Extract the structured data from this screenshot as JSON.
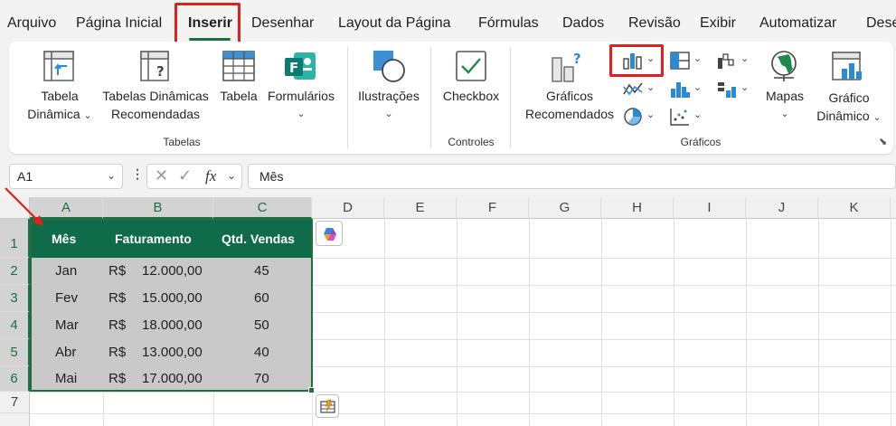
{
  "menu": {
    "tabs": [
      "Arquivo",
      "Página Inicial",
      "Inserir",
      "Desenhar",
      "Layout da Página",
      "Fórmulas",
      "Dados",
      "Revisão",
      "Exibir",
      "Automatizar",
      "Dese"
    ],
    "active": "Inserir"
  },
  "ribbon": {
    "tabela_dinamica": [
      "Tabela",
      "Dinâmica"
    ],
    "tabelas_recomendadas": [
      "Tabelas Dinâmicas",
      "Recomendadas"
    ],
    "tabela": "Tabela",
    "formularios": "Formulários",
    "ilustracoes": "Ilustrações",
    "checkbox": "Checkbox",
    "graficos_recomendados": [
      "Gráficos",
      "Recomendados"
    ],
    "mapas": "Mapas",
    "grafico_dinamico": [
      "Gráfico",
      "Dinâmico"
    ],
    "groups": {
      "tabelas": "Tabelas",
      "controles": "Controles",
      "graficos": "Gráficos"
    }
  },
  "formula_bar": {
    "name_box": "A1",
    "fx": "fx",
    "formula": "Mês"
  },
  "sheet": {
    "columns": [
      "A",
      "B",
      "C",
      "D",
      "E",
      "F",
      "G",
      "H",
      "I",
      "J",
      "K"
    ],
    "rows": [
      "1",
      "2",
      "3",
      "4",
      "5",
      "6",
      "7"
    ],
    "headers": [
      "Mês",
      "Faturamento",
      "Qtd. Vendas"
    ],
    "data": [
      {
        "mes": "Jan",
        "moeda": "R$",
        "valor": "12.000,00",
        "qtd": "45"
      },
      {
        "mes": "Fev",
        "moeda": "R$",
        "valor": "15.000,00",
        "qtd": "60"
      },
      {
        "mes": "Mar",
        "moeda": "R$",
        "valor": "18.000,00",
        "qtd": "50"
      },
      {
        "mes": "Abr",
        "moeda": "R$",
        "valor": "13.000,00",
        "qtd": "40"
      },
      {
        "mes": "Mai",
        "moeda": "R$",
        "valor": "17.000,00",
        "qtd": "70"
      }
    ]
  },
  "colors": {
    "accent": "#1d6f42",
    "header_fill": "#0f6b4a",
    "data_fill": "#c9c9c9",
    "highlight": "#e0201a"
  }
}
